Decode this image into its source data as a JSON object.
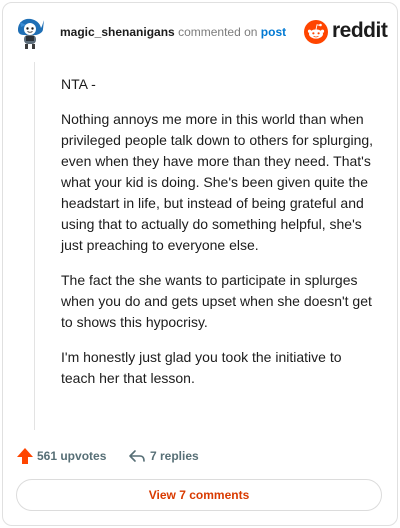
{
  "header": {
    "username": "magic_shenanigans",
    "commented_on": "commented on",
    "post_link": "post",
    "brand": "reddit"
  },
  "comment": {
    "paragraphs": [
      "NTA -",
      "Nothing annoys me more in this world than when privileged people talk down to others for splurging, even when they have more than they need. That's what your kid is doing. She's been given quite the headstart in life, but instead of being grateful and using that to actually do something helpful, she's just preaching to everyone else.",
      "The fact the she wants to participate in splurges when you do and gets upset when she doesn't get to shows this hypocrisy.",
      "I'm honestly just glad you took the initiative to teach her that lesson."
    ]
  },
  "actions": {
    "upvotes": "561 upvotes",
    "replies": "7 replies",
    "upvote_icon": "upvote-arrow-icon",
    "reply_icon": "reply-arrow-icon"
  },
  "view_comments": "View 7 comments",
  "colors": {
    "brand_orange": "#ff4500",
    "link_blue": "#0079d3",
    "view_button_text": "#d93a00",
    "upvote_arrow": "#ff4500"
  }
}
